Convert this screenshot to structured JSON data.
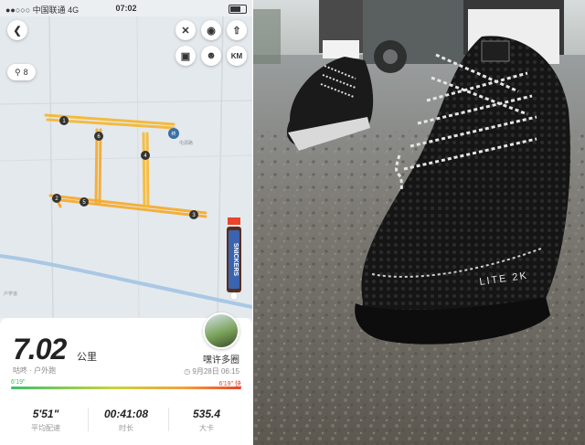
{
  "status_bar": {
    "carrier": "●●○○○ 中国联通 4G",
    "time": "07:02"
  },
  "map": {
    "photo_count": "8",
    "km_button": "KM",
    "route_color": "#f5b52a",
    "markers": [
      "1",
      "2",
      "3",
      "4",
      "5",
      "6"
    ],
    "start_marker": "终",
    "road_label": "屯源路",
    "place_label": "户学道",
    "ad_label": "SNICKERS"
  },
  "summary": {
    "distance": "7.02",
    "distance_unit": "公里",
    "activity": "咕咚 · 户外跑",
    "username": "嘿许多圈",
    "date": "9月28日 06:15",
    "pace_min": "6'19\"",
    "pace_max": "6'19\" 快"
  },
  "stats": [
    {
      "value": "5'51\"",
      "label": "平均配速"
    },
    {
      "value": "00:41:08",
      "label": "时长"
    },
    {
      "value": "535.4",
      "label": "大卡"
    }
  ],
  "photo": {
    "shoe_text": "LITE 2K"
  },
  "colors": {
    "accent": "#f5b52a",
    "pace_start": "#3fbf6a",
    "pace_end": "#e8452c"
  }
}
